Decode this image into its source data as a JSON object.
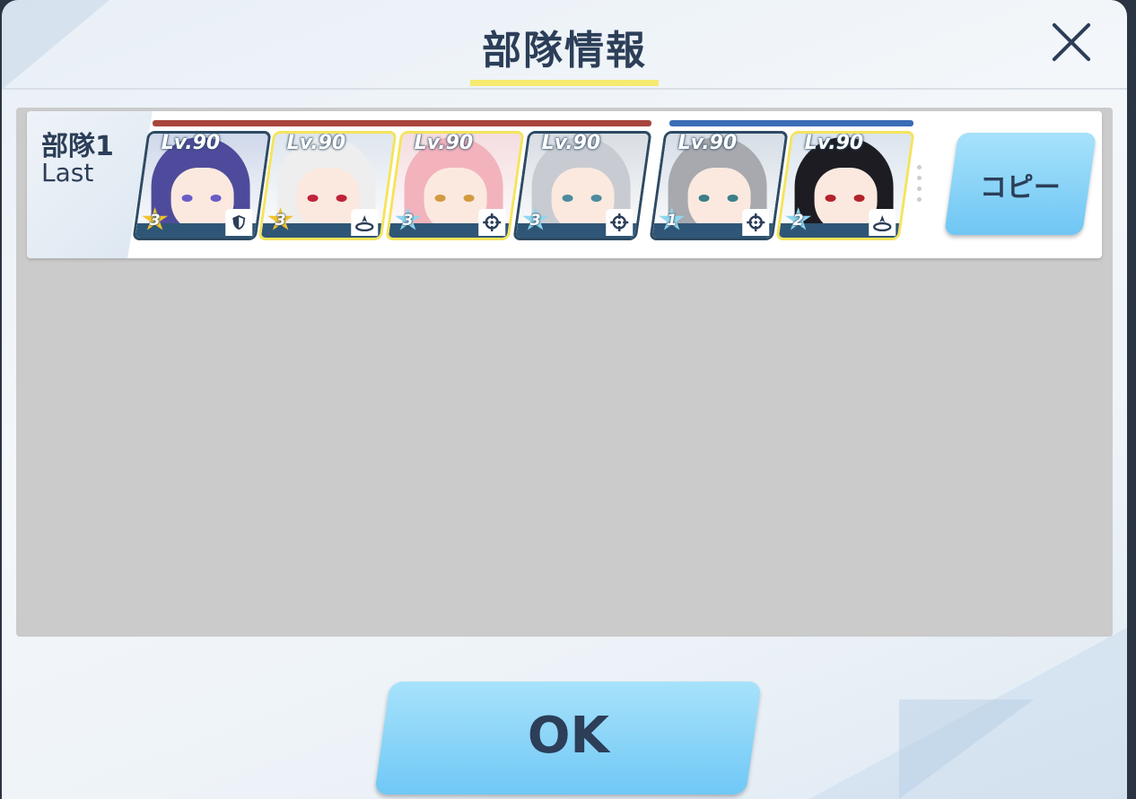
{
  "dialog": {
    "title": "部隊情報",
    "close_icon": "close-icon"
  },
  "squad": {
    "name": "部隊1",
    "subtitle": "Last",
    "copy_label": "コピー",
    "members": [
      {
        "level": "Lv.90",
        "stars": "3",
        "star_color": "#f2c230",
        "role_icon": "shield-icon",
        "hair": "#4f4b9c",
        "eye": "#6a5dc7",
        "bg": "#cfd8ea",
        "gold": false
      },
      {
        "level": "Lv.90",
        "stars": "3",
        "star_color": "#f2c230",
        "role_icon": "support-icon",
        "hair": "#eeeeef",
        "eye": "#c0233a",
        "bg": "#dfe6ee",
        "gold": true
      },
      {
        "level": "Lv.90",
        "stars": "3",
        "star_color": "#8fd6ee",
        "role_icon": "crosshair-icon",
        "hair": "#f2b3bd",
        "eye": "#d39a3e",
        "bg": "#f4dde0",
        "gold": true
      },
      {
        "level": "Lv.90",
        "stars": "3",
        "star_color": "#8fd6ee",
        "role_icon": "crosshair-icon",
        "hair": "#c8cbd1",
        "eye": "#4f8a9e",
        "bg": "#d8dde3",
        "gold": false
      },
      {
        "level": "Lv.90",
        "stars": "1",
        "star_color": "#8fd6ee",
        "role_icon": "crosshair-icon",
        "hair": "#a7a9ae",
        "eye": "#3a7f8a",
        "bg": "#d6dde6",
        "gold": false
      },
      {
        "level": "Lv.90",
        "stars": "2",
        "star_color": "#8fd6ee",
        "role_icon": "support-icon",
        "hair": "#1d1c22",
        "eye": "#b4222d",
        "bg": "#dbe4ee",
        "gold": true
      }
    ]
  },
  "footer": {
    "ok_label": "OK"
  },
  "colors": {
    "title": "#2c3e58",
    "underline": "#f6ea70",
    "striker_bar": "#a8453d",
    "special_bar": "#3a6db5",
    "button": "#8fd6f8"
  }
}
